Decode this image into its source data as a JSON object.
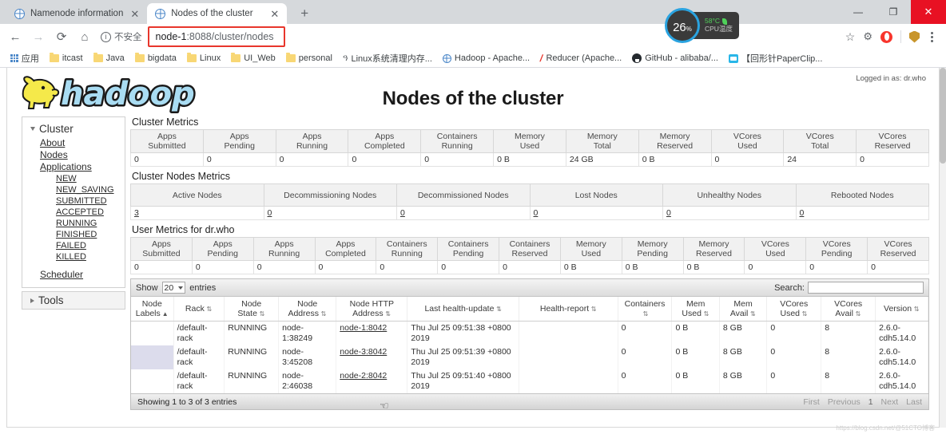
{
  "browser": {
    "tabs": [
      {
        "label": "Namenode information",
        "active": false,
        "icon": "globe-icon"
      },
      {
        "label": "Nodes of the cluster",
        "active": true,
        "icon": "globe-icon"
      }
    ],
    "new_tab_label": "+",
    "window_controls": {
      "minimize": "—",
      "maximize": "❐",
      "close": "✕"
    },
    "nav": {
      "back": "←",
      "forward": "→",
      "reload": "⟳",
      "home": "⌂"
    },
    "security_label": "不安全",
    "url_strong": "node-1",
    "url_rest": ":8088/cluster/nodes",
    "url_full": "node-1:8088/cluster/nodes",
    "right_icons": {
      "bookmark_star": "☆",
      "extension": "extension-icon",
      "opera": "opera-icon",
      "shield": "shield-icon",
      "menu": "kebab-menu-icon"
    },
    "bookmarks": [
      {
        "label": "应用",
        "icon": "apps-grid-icon"
      },
      {
        "label": "itcast",
        "icon": "folder-icon"
      },
      {
        "label": "Java",
        "icon": "folder-icon"
      },
      {
        "label": "bigdata",
        "icon": "folder-icon"
      },
      {
        "label": "Linux",
        "icon": "folder-icon"
      },
      {
        "label": "UI_Web",
        "icon": "folder-icon"
      },
      {
        "label": "personal",
        "icon": "folder-icon"
      },
      {
        "label": "Linux系统清理内存...",
        "icon": "csdn-icon"
      },
      {
        "label": "Hadoop - Apache...",
        "icon": "globe-icon"
      },
      {
        "label": "Reducer (Apache...",
        "icon": "slash-icon"
      },
      {
        "label": "GitHub - alibaba/...",
        "icon": "github-icon"
      },
      {
        "label": "【回形针PaperClip...",
        "icon": "bilibili-icon"
      }
    ]
  },
  "cpu_widget": {
    "percent": "26",
    "percent_unit": "%",
    "temp": "58°C",
    "label": "CPU温度"
  },
  "page": {
    "logged_in": "Logged in as: dr.who",
    "title": "Nodes of the cluster",
    "logo_alt": "hadoop"
  },
  "sidebar": {
    "cluster_header": "Cluster",
    "items": [
      {
        "label": "About",
        "level": 1
      },
      {
        "label": "Nodes",
        "level": 1
      },
      {
        "label": "Applications",
        "level": 1
      },
      {
        "label": "NEW",
        "level": 2
      },
      {
        "label": "NEW_SAVING",
        "level": 2
      },
      {
        "label": "SUBMITTED",
        "level": 2
      },
      {
        "label": "ACCEPTED",
        "level": 2
      },
      {
        "label": "RUNNING",
        "level": 2
      },
      {
        "label": "FINISHED",
        "level": 2
      },
      {
        "label": "FAILED",
        "level": 2
      },
      {
        "label": "KILLED",
        "level": 2
      },
      {
        "label": "Scheduler",
        "level": 1
      }
    ],
    "tools_header": "Tools"
  },
  "cluster_metrics": {
    "title": "Cluster Metrics",
    "headers": [
      [
        "Apps",
        "Submitted"
      ],
      [
        "Apps",
        "Pending"
      ],
      [
        "Apps",
        "Running"
      ],
      [
        "Apps",
        "Completed"
      ],
      [
        "Containers",
        "Running"
      ],
      [
        "Memory",
        "Used"
      ],
      [
        "Memory",
        "Total"
      ],
      [
        "Memory",
        "Reserved"
      ],
      [
        "VCores",
        "Used"
      ],
      [
        "VCores",
        "Total"
      ],
      [
        "VCores",
        "Reserved"
      ]
    ],
    "values": [
      "0",
      "0",
      "0",
      "0",
      "0",
      "0 B",
      "24 GB",
      "0 B",
      "0",
      "24",
      "0"
    ]
  },
  "cluster_nodes_metrics": {
    "title": "Cluster Nodes Metrics",
    "headers": [
      "Active Nodes",
      "Decommissioning Nodes",
      "Decommissioned Nodes",
      "Lost Nodes",
      "Unhealthy Nodes",
      "Rebooted Nodes"
    ],
    "values": [
      "3",
      "0",
      "0",
      "0",
      "0",
      "0"
    ]
  },
  "user_metrics": {
    "title": "User Metrics for dr.who",
    "headers": [
      [
        "Apps",
        "Submitted"
      ],
      [
        "Apps",
        "Pending"
      ],
      [
        "Apps",
        "Running"
      ],
      [
        "Apps",
        "Completed"
      ],
      [
        "Containers",
        "Running"
      ],
      [
        "Containers",
        "Pending"
      ],
      [
        "Containers",
        "Reserved"
      ],
      [
        "Memory",
        "Used"
      ],
      [
        "Memory",
        "Pending"
      ],
      [
        "Memory",
        "Reserved"
      ],
      [
        "VCores",
        "Used"
      ],
      [
        "VCores",
        "Pending"
      ],
      [
        "VCores",
        "Reserved"
      ]
    ],
    "values": [
      "0",
      "0",
      "0",
      "0",
      "0",
      "0",
      "0",
      "0 B",
      "0 B",
      "0 B",
      "0",
      "0",
      "0"
    ]
  },
  "datatable": {
    "show_label": "Show",
    "entries_label": "entries",
    "page_size": "20",
    "search_label": "Search:",
    "search_value": "",
    "search_placeholder": "",
    "columns": [
      {
        "line1": "Node",
        "line2": "Labels",
        "sort": "asc"
      },
      {
        "line1": "Rack",
        "line2": "",
        "sort": "both"
      },
      {
        "line1": "Node",
        "line2": "State",
        "sort": "both"
      },
      {
        "line1": "Node",
        "line2": "Address",
        "sort": "both"
      },
      {
        "line1": "Node HTTP",
        "line2": "Address",
        "sort": "both"
      },
      {
        "line1": "Last health-update",
        "line2": "",
        "sort": "both"
      },
      {
        "line1": "Health-report",
        "line2": "",
        "sort": "both"
      },
      {
        "line1": "Containers",
        "line2": "",
        "sort": "both"
      },
      {
        "line1": "Mem",
        "line2": "Used",
        "sort": "both"
      },
      {
        "line1": "Mem",
        "line2": "Avail",
        "sort": "both"
      },
      {
        "line1": "VCores",
        "line2": "Used",
        "sort": "both"
      },
      {
        "line1": "VCores",
        "line2": "Avail",
        "sort": "both"
      },
      {
        "line1": "Version",
        "line2": "",
        "sort": "both"
      }
    ],
    "rows": [
      {
        "node_labels": "",
        "rack": "/default-rack",
        "node_state": "RUNNING",
        "node_address": "node-1:38249",
        "node_http_address": "node-1:8042",
        "last_health_update": "Thu Jul 25 09:51:38 +0800 2019",
        "health_report": "",
        "containers": "0",
        "mem_used": "0 B",
        "mem_avail": "8 GB",
        "vcores_used": "0",
        "vcores_avail": "8",
        "version": "2.6.0-cdh5.14.0",
        "highlight": false
      },
      {
        "node_labels": "",
        "rack": "/default-rack",
        "node_state": "RUNNING",
        "node_address": "node-3:45208",
        "node_http_address": "node-3:8042",
        "last_health_update": "Thu Jul 25 09:51:39 +0800 2019",
        "health_report": "",
        "containers": "0",
        "mem_used": "0 B",
        "mem_avail": "8 GB",
        "vcores_used": "0",
        "vcores_avail": "8",
        "version": "2.6.0-cdh5.14.0",
        "highlight": true
      },
      {
        "node_labels": "",
        "rack": "/default-rack",
        "node_state": "RUNNING",
        "node_address": "node-2:46038",
        "node_http_address": "node-2:8042",
        "last_health_update": "Thu Jul 25 09:51:40 +0800 2019",
        "health_report": "",
        "containers": "0",
        "mem_used": "0 B",
        "mem_avail": "8 GB",
        "vcores_used": "0",
        "vcores_avail": "8",
        "version": "2.6.0-cdh5.14.0",
        "highlight": false
      }
    ],
    "showing_text": "Showing 1 to 3 of 3 entries",
    "pager": [
      "First",
      "Previous",
      "1",
      "Next",
      "Last"
    ],
    "pager_current": "1"
  },
  "watermark": "https://blog.csdn.net/@51CTO博客",
  "colors": {
    "accent_red": "#e8362c",
    "hadoop_yellow": "#f7e63a",
    "hadoop_blue": "#9fd9f0",
    "highlight_cell": "#dcdcec",
    "cpu_ring": "#2aa3e0"
  }
}
